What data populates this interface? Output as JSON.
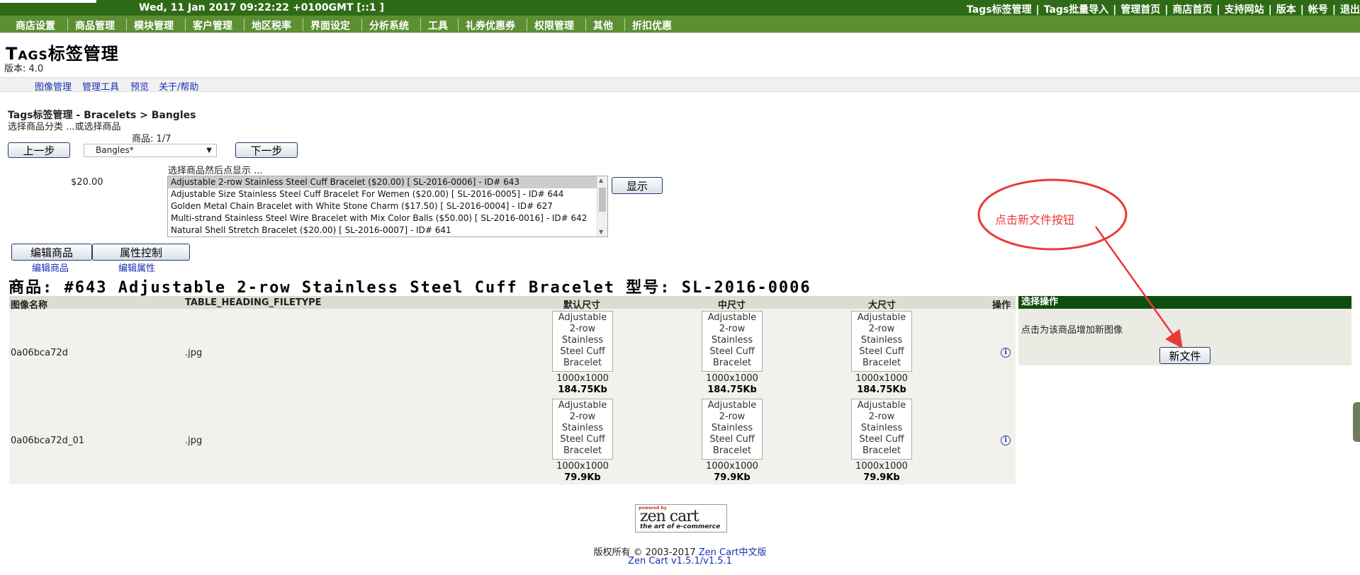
{
  "topbar": {
    "date": "Wed, 11 Jan 2017 09:22:22 +0100GMT [::1 ]",
    "links": [
      "Tags标签管理",
      "Tags批量导入",
      "管理首页",
      "商店首页",
      "支持网站",
      "版本",
      "帐号",
      "退出"
    ]
  },
  "menu": [
    "商店设置",
    "商品管理",
    "模块管理",
    "客户管理",
    "地区税率",
    "界面设定",
    "分析系统",
    "工具",
    "礼券优惠券",
    "权限管理",
    "其他",
    "折扣优惠"
  ],
  "header": {
    "title_caps": "Tags",
    "title_rest": "标签管理",
    "version": "版本: 4.0"
  },
  "subnav": [
    "图像管理",
    "管理工具",
    "预览",
    "关于/帮助"
  ],
  "breadcrumb": "Tags标签管理 - Bracelets > Bangles",
  "select_category_text": "选择商品分类 ...或选择商品",
  "product_count": "商品: 1/7",
  "buttons": {
    "prev": "上一步",
    "next": "下一步",
    "display": "显示",
    "edit_product": "编辑商品",
    "attr_control": "属性控制",
    "new_file": "新文件"
  },
  "category_select": "Bangles*",
  "price": "$20.00",
  "select_hint": "选择商品然后点显示 ...",
  "product_options": [
    "Adjustable 2-row Stainless Steel Cuff Bracelet ($20.00) [ SL-2016-0006] - ID# 643",
    "Adjustable Size Stainless Steel Cuff Bracelet For Wemen ($20.00) [ SL-2016-0005] - ID# 644",
    "Golden Metal Chain Bracelet with White Stone Charm ($17.50) [ SL-2016-0004] - ID# 627",
    "Multi-strand Stainless Steel Wire Bracelet with Mix Color Balls ($50.00) [ SL-2016-0016] - ID# 642",
    "Natural Shell Stretch Bracelet ($20.00) [ SL-2016-0007] - ID# 641"
  ],
  "sublinks": {
    "edit_product": "编辑商品",
    "edit_attr": "编辑属性"
  },
  "product_heading": "商品: #643  Adjustable 2-row Stainless Steel Cuff Bracelet   型号: SL-2016-0006",
  "table": {
    "headers": [
      "图像名称",
      "TABLE_HEADING_FILETYPE",
      "默认尺寸",
      "中尺寸",
      "大尺寸",
      "操作"
    ],
    "alt_text": "Adjustable 2-row Stainless Steel Cuff Bracelet",
    "rows": [
      {
        "name": "0a06bca72d",
        "type": ".jpg",
        "dims": "1000x1000",
        "size": "184.75Kb"
      },
      {
        "name": "0a06bca72d_01",
        "type": ".jpg",
        "dims": "1000x1000",
        "size": "79.9Kb"
      }
    ]
  },
  "sidebox": {
    "heading": "选择操作",
    "text": "点击为该商品增加新图像"
  },
  "annotation": "点击新文件按钮",
  "logo": {
    "top": "powered by",
    "main": "zen cart",
    "tag": "the art of e-commerce"
  },
  "footer": {
    "copyright_prefix": "版权所有 © 2003-2017 ",
    "copyright_link": "Zen Cart中文版",
    "version_link": "Zen Cart v1.5.1/v1.5.1"
  },
  "colors": {
    "topbar": "#2f6b16",
    "menubar": "#5b8f32",
    "annotation": "#e83a3a",
    "sidebox_header": "#0f4d0f"
  }
}
